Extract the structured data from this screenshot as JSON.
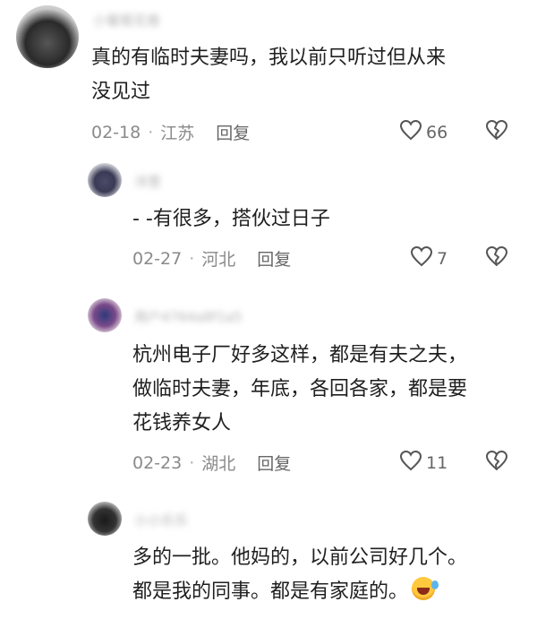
{
  "comments": [
    {
      "username": "小葡萄花卷",
      "text_lines": [
        "真的有临时夫妻吗，我以前只听过但从来",
        "没见过"
      ],
      "date": "02-18",
      "location": "江苏",
      "reply_label": "回复",
      "likes": "66"
    },
    {
      "username": "洋葱",
      "text_lines": [
        "- -有很多，搭伙过日子"
      ],
      "date": "02-27",
      "location": "河北",
      "reply_label": "回复",
      "likes": "7"
    },
    {
      "username": "用户4764a8f1a5",
      "text_lines": [
        "杭州电子厂好多这样，都是有夫之夫，",
        "做临时夫妻，年底，各回各家，都是要",
        "花钱养女人"
      ],
      "date": "02-23",
      "location": "湖北",
      "reply_label": "回复",
      "likes": "11"
    },
    {
      "username": "小小乐乐",
      "text_lines": [
        "多的一批。他妈的，以前公司好几个。",
        "都是我的同事。都是有家庭的。"
      ],
      "emoji": "rofl"
    }
  ],
  "colors": {
    "text": "#1f1f1f",
    "meta": "#8a8a8a",
    "icon": "#555555"
  }
}
